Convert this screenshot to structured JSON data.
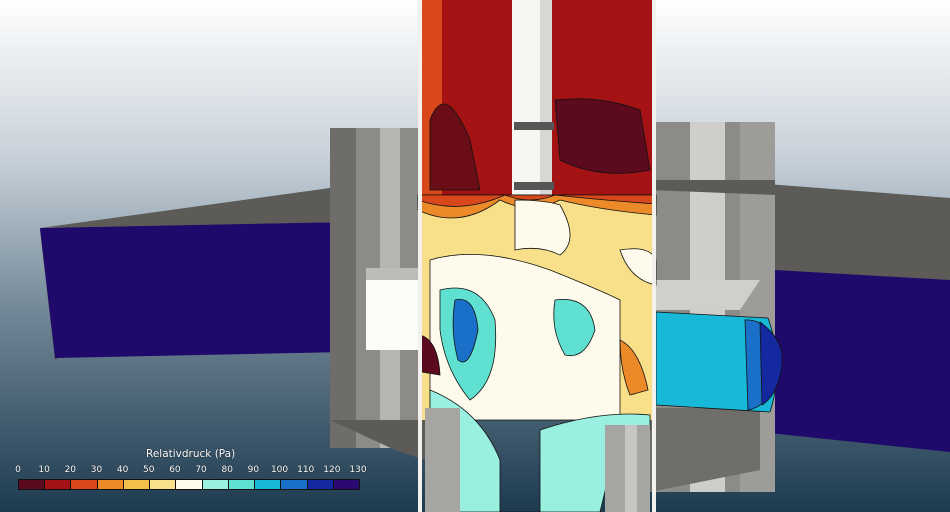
{
  "legend": {
    "title": "Relativdruck (Pa)",
    "ticks": [
      "0",
      "10",
      "20",
      "30",
      "40",
      "50",
      "60",
      "70",
      "80",
      "90",
      "100",
      "110",
      "120",
      "130"
    ],
    "colors": [
      "#5c0a1e",
      "#a41214",
      "#d8481a",
      "#ec8a2a",
      "#f4bf4a",
      "#f8e08a",
      "#fffbec",
      "#9af0e0",
      "#5fe0d0",
      "#18b8d8",
      "#1a70c8",
      "#1428a0",
      "#2a0a70"
    ]
  },
  "colors": {
    "pipe_flange": "#1f0a6b",
    "metal_dark": "#7c7b78",
    "metal_light": "#d8d7d3",
    "contour_line": "#111111"
  }
}
